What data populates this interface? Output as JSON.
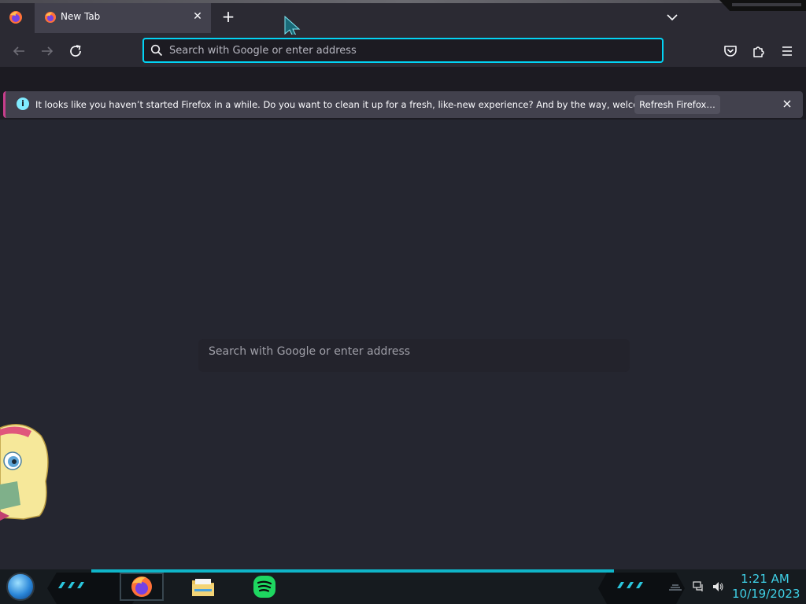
{
  "tabs": {
    "active_title": "New Tab",
    "close_label": "✕",
    "new_tab_label": "+"
  },
  "navbar": {
    "url_placeholder": "Search with Google or enter address"
  },
  "notification": {
    "message": "It looks like you haven’t started Firefox in a while. Do you want to clean it up for a fresh, like-new experience? And by the way, welcome back!",
    "button_label": "Refresh Firefox…",
    "info_glyph": "i"
  },
  "content": {
    "search_placeholder": "Search with Google or enter address"
  },
  "taskbar": {
    "time": "1:21 AM",
    "date": "10/19/2023",
    "pinned": [
      "firefox-icon",
      "file-explorer-icon",
      "spotify-icon"
    ]
  },
  "colors": {
    "accent": "#00ddff",
    "toolbar": "#2b2a33",
    "content_bg": "#252630",
    "clock": "#3fd0e6"
  }
}
